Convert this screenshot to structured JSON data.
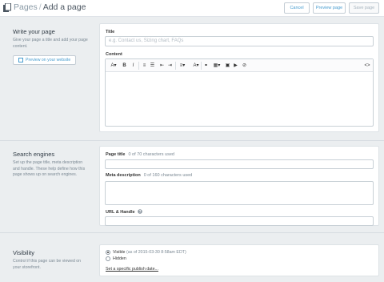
{
  "header": {
    "breadcrumb_parent": "Pages",
    "breadcrumb_sep": "/",
    "title": "Add a page",
    "cancel_label": "Cancel",
    "preview_label": "Preview page",
    "save_label": "Save page"
  },
  "write": {
    "title": "Write your page",
    "description": "Give your page a title and add your page content.",
    "preview_button": "Preview on your website",
    "title_label": "Title",
    "title_placeholder": "e.g. Contact us, Sizing chart, FAQs",
    "content_label": "Content",
    "toolbar": [
      {
        "name": "font-size-dropdown",
        "glyph": "A▾"
      },
      {
        "name": "bold-button",
        "glyph": "B"
      },
      {
        "name": "italic-button",
        "glyph": "I"
      },
      {
        "name": "bullet-list-button",
        "glyph": "≡"
      },
      {
        "name": "numbered-list-button",
        "glyph": "☰"
      },
      {
        "name": "outdent-button",
        "glyph": "⇤"
      },
      {
        "name": "indent-button",
        "glyph": "⇥"
      },
      {
        "name": "align-dropdown",
        "glyph": "≡▾"
      },
      {
        "name": "text-color-dropdown",
        "glyph": "A▾"
      },
      {
        "name": "link-button",
        "glyph": "⚭"
      },
      {
        "name": "table-dropdown",
        "glyph": "▦▾"
      },
      {
        "name": "image-button",
        "glyph": "▣"
      },
      {
        "name": "video-button",
        "glyph": "▶"
      },
      {
        "name": "remove-format-button",
        "glyph": "⊘"
      },
      {
        "name": "html-toggle-button",
        "glyph": "<>"
      }
    ]
  },
  "seo": {
    "title": "Search engines",
    "description": "Set up the page title, meta description and handle. These help define how this page shows up on search engines.",
    "page_title_label": "Page title",
    "page_title_count": "0 of 70 characters used",
    "meta_label": "Meta description",
    "meta_count": "0 of 160 characters used",
    "url_label": "URL & Handle"
  },
  "visibility": {
    "title": "Visibility",
    "description": "Control if this page can be viewed on your storefront.",
    "visible_label": "Visible",
    "visible_note": "(as of 2015-03-30 8:58am EDT)",
    "hidden_label": "Hidden",
    "publish_link": "Set a specific publish date..."
  },
  "colors": {
    "background": "#ebeef0",
    "accent": "#479ccf",
    "text": "#333333",
    "muted": "#7a8893"
  }
}
